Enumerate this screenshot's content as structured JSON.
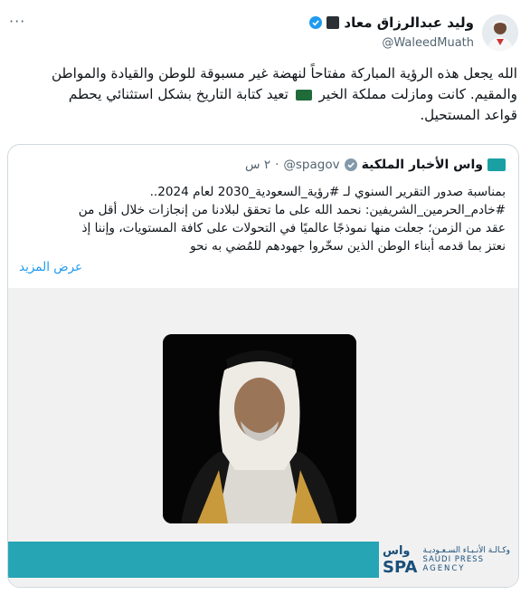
{
  "menu": {
    "more_label": "···"
  },
  "author": {
    "name": "وليد عبدالرزاق معاد",
    "handle": "@WaleedMuath",
    "verified_color": "#1d9bf0"
  },
  "tweet": {
    "line1": "الله يجعل هذه الرؤية المباركة مفتاحاً لنهضة غير مسبوقة للوطن والقيادة والمواطن",
    "line2_part1": "والمقيم. كانت ومازلت مملكة الخير",
    "line2_part2": "تعيد كتابة التاريخ بشكل استثنائي يحطم",
    "line3": "قواعد المستحيل."
  },
  "quote": {
    "name": "واس الأخبار الملكية",
    "handle": "@spagov",
    "separator": "·",
    "time": "٢ س",
    "text_line1": "بمناسبة صدور التقرير السنوي لـ #رؤية_السعودية_2030 لعام 2024..",
    "text_line2": "#خادم_الحرمين_الشريفين: نحمد الله على ما تحقق لبلادنا من إنجازات خلال أقل من",
    "text_line3": "عقد من الزمن؛ جعلت منها نموذجًا عالميًا في التحولات على كافة المستويات، وإننا إذ",
    "text_line4": "نعتز بما قدمه أبناء الوطن الذين سخّروا جهودهم للمُضي به نحو",
    "show_more": "عرض المزيد"
  },
  "media": {
    "brand_mark_top": "واس",
    "brand_mark_bottom": "SPA",
    "brand_ar": "وكـالـة الأنـبـاء السـعـوديـة",
    "brand_en_1": "SAUDI PRESS",
    "brand_en_2": "AGENCY",
    "band_color": "#26a5b5"
  }
}
